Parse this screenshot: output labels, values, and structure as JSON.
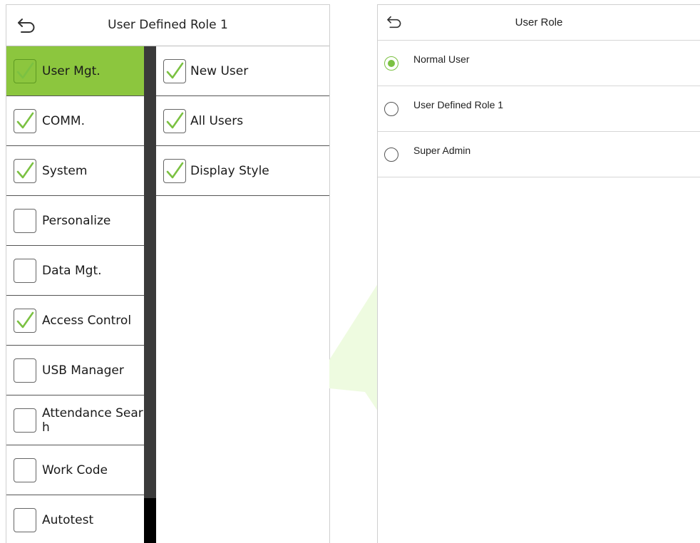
{
  "left_screen": {
    "title": "User Defined Role 1",
    "menu": [
      {
        "label": "User Mgt.",
        "checked": true,
        "active": true
      },
      {
        "label": "COMM.",
        "checked": true,
        "active": false
      },
      {
        "label": "System",
        "checked": true,
        "active": false
      },
      {
        "label": "Personalize",
        "checked": false,
        "active": false
      },
      {
        "label": "Data Mgt.",
        "checked": false,
        "active": false
      },
      {
        "label": "Access Control",
        "checked": true,
        "active": false
      },
      {
        "label": "USB Manager",
        "checked": false,
        "active": false
      },
      {
        "label": "Attendance Sear\nh",
        "checked": false,
        "active": false
      },
      {
        "label": "Work Code",
        "checked": false,
        "active": false
      },
      {
        "label": "Autotest",
        "checked": false,
        "active": false
      }
    ],
    "submenu": [
      {
        "label": "New User",
        "checked": true
      },
      {
        "label": "All Users",
        "checked": true
      },
      {
        "label": "Display Style",
        "checked": true
      }
    ]
  },
  "right_screen": {
    "title": "User Role",
    "options": [
      {
        "label": "Normal User",
        "selected": true
      },
      {
        "label": "User Defined Role 1",
        "selected": false
      },
      {
        "label": "Super Admin",
        "selected": false
      }
    ]
  },
  "colors": {
    "accent_green": "#8cc63e",
    "radio_green": "#7bc142",
    "check_green": "#7bc142"
  },
  "icons": {
    "back": "back-arrow-icon",
    "check": "checkmark-icon",
    "radio": "radio-icon"
  }
}
